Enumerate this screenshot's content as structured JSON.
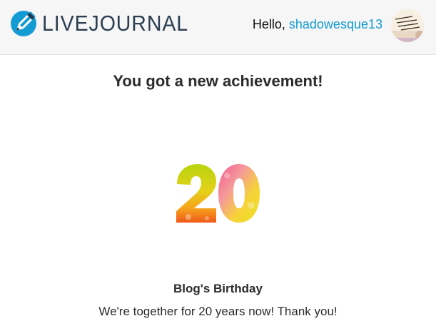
{
  "header": {
    "logo_text": "LIVEJOURNAL",
    "greeting_prefix": "Hello,",
    "username": "shadowesque13"
  },
  "achievement": {
    "heading": "You got a new achievement!",
    "badge_number": "20",
    "name": "Blog's Birthday",
    "description": "We're together for 20 years now! Thank you!"
  },
  "colors": {
    "brand_blue": "#139bd4",
    "logo_text": "#2c3e50",
    "header_bg": "#f6f6f6"
  }
}
